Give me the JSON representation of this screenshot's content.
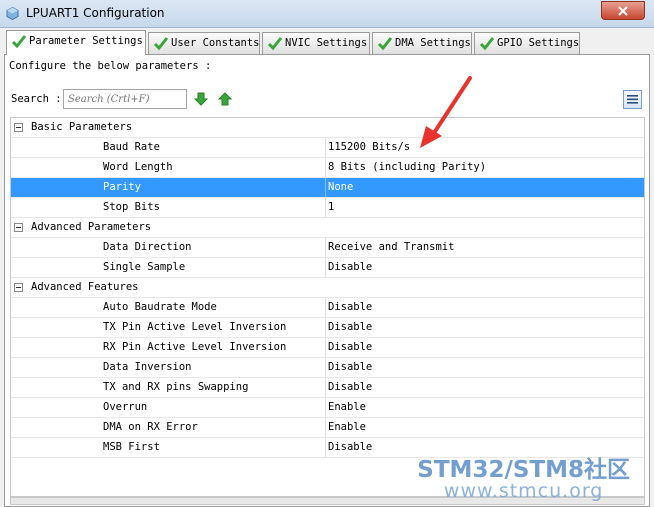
{
  "window": {
    "title": "LPUART1 Configuration"
  },
  "tabs": [
    {
      "label": "Parameter Settings",
      "active": true
    },
    {
      "label": "User Constants",
      "active": false
    },
    {
      "label": "NVIC Settings",
      "active": false
    },
    {
      "label": "DMA Settings",
      "active": false
    },
    {
      "label": "GPIO Settings",
      "active": false
    }
  ],
  "instructions": "Configure the below parameters :",
  "search": {
    "label": "Search :",
    "placeholder": "Search (Crtl+F)"
  },
  "groups": [
    {
      "label": "Basic Parameters",
      "items": [
        {
          "name": "Baud Rate",
          "value": "115200 Bits/s"
        },
        {
          "name": "Word Length",
          "value": "8 Bits (including Parity)"
        },
        {
          "name": "Parity",
          "value": "None",
          "selected": true
        },
        {
          "name": "Stop Bits",
          "value": "1"
        }
      ]
    },
    {
      "label": "Advanced Parameters",
      "items": [
        {
          "name": "Data Direction",
          "value": "Receive and Transmit"
        },
        {
          "name": "Single Sample",
          "value": "Disable"
        }
      ]
    },
    {
      "label": "Advanced Features",
      "items": [
        {
          "name": "Auto Baudrate Mode",
          "value": "Disable"
        },
        {
          "name": "TX Pin Active Level Inversion",
          "value": "Disable"
        },
        {
          "name": "RX Pin Active Level Inversion",
          "value": "Disable"
        },
        {
          "name": "Data Inversion",
          "value": "Disable"
        },
        {
          "name": "TX and RX pins Swapping",
          "value": "Disable"
        },
        {
          "name": "Overrun",
          "value": "Enable"
        },
        {
          "name": "DMA on RX Error",
          "value": "Enable"
        },
        {
          "name": "MSB First",
          "value": "Disable"
        }
      ]
    }
  ],
  "watermark": {
    "title": "STM32/STM8社区",
    "subtitle": "www.stmcu.org"
  },
  "colors": {
    "selection": "#3399ff",
    "check": "#3aa63a",
    "annotation_arrow": "#e8322d",
    "watermark": "#5a8fc8"
  }
}
